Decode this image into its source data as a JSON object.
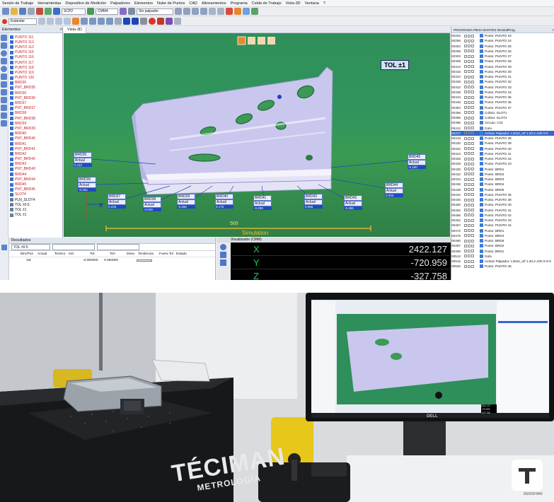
{
  "menu": [
    "Sesión de Trabajo",
    "Herramientas",
    "Dispositivo de Medición",
    "Palpadores",
    "Elementos",
    "Nube de Puntos",
    "CAD",
    "Alineamientos",
    "Programa",
    "Celda de Trabajo",
    "Vista-3D",
    "Ventana",
    "?"
  ],
  "toolbar": {
    "probe_select": "SCP2",
    "cmm_select": "CMM4",
    "alignment_select": "Sin palpador",
    "mode_select": "Estándar"
  },
  "elements_panel": {
    "title": "Elementos",
    "items": [
      {
        "label": "PUNTO 111",
        "color": "red"
      },
      {
        "label": "PUNTO 112",
        "color": "red"
      },
      {
        "label": "PUNTO 113",
        "color": "red"
      },
      {
        "label": "PUNTO 115",
        "color": "red"
      },
      {
        "label": "PUNTO 116",
        "color": "red"
      },
      {
        "label": "PUNTO 117",
        "color": "red"
      },
      {
        "label": "PUNTO 118",
        "color": "red"
      },
      {
        "label": "PUNTO 119",
        "color": "red"
      },
      {
        "label": "PUNTO 120",
        "color": "red"
      },
      {
        "label": "BRD35",
        "color": "red"
      },
      {
        "label": "PNT_BRD35",
        "color": "red"
      },
      {
        "label": "BRD36",
        "color": "red"
      },
      {
        "label": "PNT_BRD36",
        "color": "red"
      },
      {
        "label": "BRD37",
        "color": "red"
      },
      {
        "label": "PNT_BRD37",
        "color": "red"
      },
      {
        "label": "BRD38",
        "color": "red"
      },
      {
        "label": "PNT_BRD38",
        "color": "red"
      },
      {
        "label": "BRD39",
        "color": "red"
      },
      {
        "label": "PNT_BRD39",
        "color": "red"
      },
      {
        "label": "BRD40",
        "color": "red"
      },
      {
        "label": "PNT_BRD40",
        "color": "red"
      },
      {
        "label": "BRD41",
        "color": "red"
      },
      {
        "label": "PNT_BRD41",
        "color": "red"
      },
      {
        "label": "BRD42",
        "color": "red"
      },
      {
        "label": "PNT_BRD42",
        "color": "red"
      },
      {
        "label": "BRD43",
        "color": "red"
      },
      {
        "label": "PNT_BRD43",
        "color": "red"
      },
      {
        "label": "BRD44",
        "color": "red"
      },
      {
        "label": "PNT_BRD44",
        "color": "red"
      },
      {
        "label": "BRD45",
        "color": "red"
      },
      {
        "label": "PNT_BRD45",
        "color": "red"
      },
      {
        "label": "SLOT4",
        "color": "red"
      },
      {
        "label": "PLN_SLOT4",
        "color": "black"
      },
      {
        "label": "TOL ±0.5",
        "color": "black"
      },
      {
        "label": "TOL ±1",
        "color": "black"
      },
      {
        "label": "TOL ±1",
        "color": "black"
      }
    ]
  },
  "viewport": {
    "tab": "Vista-3D",
    "tolerance_badge": "TOL ±1",
    "scale_value": "500",
    "mode_label": "Simulation",
    "callouts": [
      {
        "name": "BRD35",
        "actual": "Actual",
        "dev": "0.113"
      },
      {
        "name": "BRD36",
        "actual": "Actual",
        "dev": "-0.262"
      },
      {
        "name": "BRD37",
        "actual": "Actual",
        "dev": "0.233"
      },
      {
        "name": "BRD38",
        "actual": "Actual",
        "dev": "-0.029"
      },
      {
        "name": "BRD39",
        "actual": "Actual",
        "dev": "-0.256"
      },
      {
        "name": "BRD40",
        "actual": "Actual",
        "dev": "0.175"
      },
      {
        "name": "BRD41",
        "actual": "Actual",
        "dev": "-0.209"
      },
      {
        "name": "BRD42",
        "actual": "Actual",
        "dev": "0.056"
      },
      {
        "name": "BRD43",
        "actual": "Actual",
        "dev": "-0.286"
      },
      {
        "name": "BRD44",
        "actual": "Actual",
        "dev": "0.204"
      },
      {
        "name": "BRD45",
        "actual": "Actual",
        "dev": "-0.190"
      }
    ],
    "axis_x": "X"
  },
  "results_panel": {
    "title": "Resultados",
    "selector": "TOL ±0.5",
    "columns": [
      "Elm/Pos",
      "Actual",
      "Teórico",
      "Ind",
      "Tol-",
      "Tol+",
      "Desv.",
      "Tendencia",
      "Fuera Tol",
      "Estado"
    ],
    "row": {
      "elm": "Val",
      "tol_minus": "-0.050000",
      "tol_plus": "0.050000"
    }
  },
  "visualizer": {
    "title": "Visualizador (CMM)",
    "coords": [
      {
        "axis": "X",
        "value": "2422.127"
      },
      {
        "axis": "Y",
        "value": "-720.959"
      },
      {
        "axis": "Z",
        "value": "-327.758"
      }
    ]
  },
  "program_panel": {
    "title": "PROGRAMA PIEZA BANTES 05-MultProg",
    "rows": [
      {
        "num": "00263",
        "label": "Punto: PUNTO 23"
      },
      {
        "num": "00256",
        "label": "Punto: PUNTO 24"
      },
      {
        "num": "00263",
        "label": "Punto: PUNTO 25"
      },
      {
        "num": "00298",
        "label": "Punto: PUNTO 26"
      },
      {
        "num": "00303",
        "label": "Punto: PUNTO 27"
      },
      {
        "num": "00308",
        "label": "Punto: PUNTO 28"
      },
      {
        "num": "00313",
        "label": "Punto: PUNTO 29"
      },
      {
        "num": "00318",
        "label": "Punto: PUNTO 30"
      },
      {
        "num": "00323",
        "label": "Punto: PUNTO 31"
      },
      {
        "num": "00328",
        "label": "Punto: PUNTO 32"
      },
      {
        "num": "00333",
        "label": "Punto: PUNTO 33"
      },
      {
        "num": "00338",
        "label": "Punto: PUNTO 34"
      },
      {
        "num": "00343",
        "label": "Punto: PUNTO 35"
      },
      {
        "num": "00348",
        "label": "Punto: PUNTO 36"
      },
      {
        "num": "00353",
        "label": "Punto: PUNTO 37"
      },
      {
        "num": "00358",
        "label": "Colisio: SLOT1"
      },
      {
        "num": "00385",
        "label": "Colisio: SLOT2"
      },
      {
        "num": "00396",
        "label": "Circulo: Cir2"
      },
      {
        "num": "00412",
        "label": "Goto"
      },
      {
        "num": "00417",
        "label": "Activar Palpador: L20x2_mf 1.20.2.A00 0-0",
        "selected": true
      },
      {
        "num": "00418",
        "label": "Punto: PUNTO 38"
      },
      {
        "num": "00420",
        "label": "Punto: PUNTO 39"
      },
      {
        "num": "00422",
        "label": "Punto: PUNTO 40"
      },
      {
        "num": "00424",
        "label": "Punto: PUNTO 41"
      },
      {
        "num": "00426",
        "label": "Punto: PUNTO 42"
      },
      {
        "num": "00428",
        "label": "Punto: PUNTO 43"
      },
      {
        "num": "00430",
        "label": "Punto: BRD1"
      },
      {
        "num": "00432",
        "label": "Punto: BRD2"
      },
      {
        "num": "00434",
        "label": "Punto: BRD3"
      },
      {
        "num": "00436",
        "label": "Punto: BRD4"
      },
      {
        "num": "00438",
        "label": "Punto: BRD5"
      },
      {
        "num": "00442",
        "label": "Punto: PUNTO 36"
      },
      {
        "num": "00446",
        "label": "Punto: PUNTO 38"
      },
      {
        "num": "00450",
        "label": "Punto: PUNTO 40"
      },
      {
        "num": "00452",
        "label": "Punto: PUNTO 41"
      },
      {
        "num": "00456",
        "label": "Punto: PUNTO 42"
      },
      {
        "num": "00462",
        "label": "Punto: PUNTO 43"
      },
      {
        "num": "00467",
        "label": "Punto: PUNTO 44"
      },
      {
        "num": "00472",
        "label": "Punto: BRD1"
      },
      {
        "num": "00475",
        "label": "Punto: BRD4"
      },
      {
        "num": "00480",
        "label": "Punto: BRD5"
      },
      {
        "num": "00487",
        "label": "Punto: BRD2"
      },
      {
        "num": "00490",
        "label": "Punto: BRD1"
      },
      {
        "num": "00512",
        "label": "Goto"
      },
      {
        "num": "00515",
        "label": "Activar Palpador: L20x2_mf 1.20.2.A00 0-0-0"
      },
      {
        "num": "00520",
        "label": "Punto: PUNTO 45"
      }
    ]
  },
  "photo": {
    "brand_text": "TÉCIMAN",
    "brand_subtext": "METROLOGÍA",
    "monitor_brand": "DELL",
    "probe_brand": "RENISHAW",
    "monitor_coords": [
      "2422.127",
      "-720.959",
      "-327.758"
    ]
  },
  "colors": {
    "viewport_green": "#31955c",
    "accent_blue": "#1a3fa3",
    "selection_blue": "#3467c9",
    "coord_green": "#1ed05a"
  }
}
